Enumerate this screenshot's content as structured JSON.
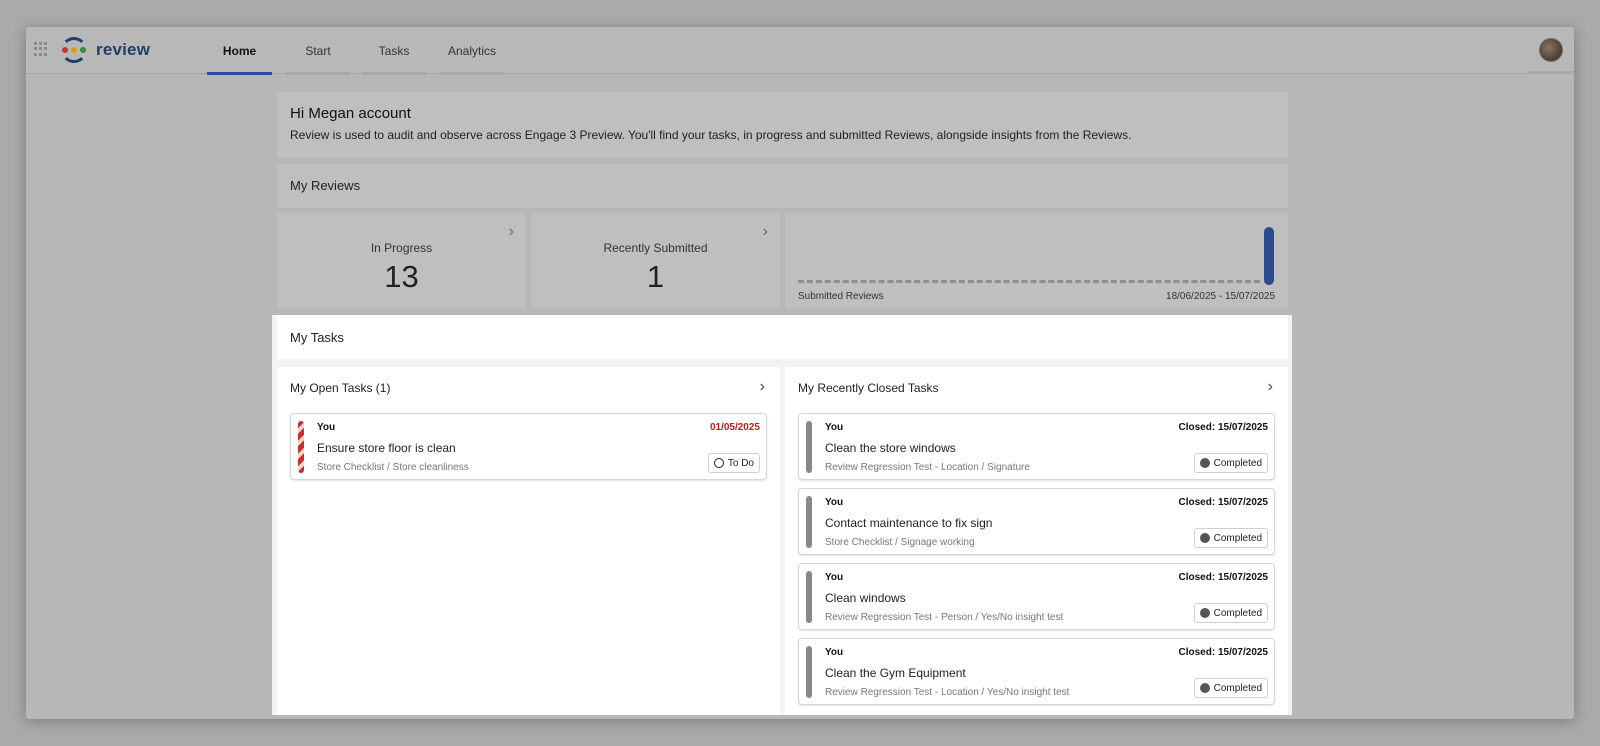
{
  "app": {
    "logo_text": "review",
    "avatar_icon": "user-avatar"
  },
  "nav": {
    "tabs": [
      {
        "label": "Home"
      },
      {
        "label": "Start"
      },
      {
        "label": "Tasks"
      },
      {
        "label": "Analytics"
      }
    ]
  },
  "greeting": {
    "title": "Hi Megan account",
    "description": "Review is used to audit and observe across Engage 3 Preview. You'll find your tasks, in progress and submitted Reviews, alongside insights from the Reviews."
  },
  "reviews": {
    "heading": "My Reviews",
    "in_progress": {
      "label": "In Progress",
      "value": "13"
    },
    "recently_submitted": {
      "label": "Recently Submitted",
      "value": "1"
    },
    "chart": {
      "label": "Submitted Reviews",
      "range": "18/06/2025 - 15/07/2025"
    }
  },
  "chart_data": {
    "type": "bar",
    "title": "Submitted Reviews",
    "x_range": [
      "18/06/2025",
      "15/07/2025"
    ],
    "series": [
      {
        "values": [
          0,
          0,
          0,
          0,
          0,
          0,
          0,
          0,
          0,
          0,
          0,
          0,
          0,
          0,
          0,
          0,
          0,
          0,
          0,
          0,
          0,
          0,
          0,
          0,
          0,
          0,
          0,
          1
        ]
      }
    ],
    "bar_color": "#2b4b8c"
  },
  "tasks": {
    "heading": "My Tasks",
    "open": {
      "heading": "My Open Tasks (1)",
      "items": [
        {
          "who": "You",
          "date": "01/05/2025",
          "title": "Ensure store floor is clean",
          "path": "Store Checklist / Store cleanliness",
          "status": "To Do"
        }
      ]
    },
    "closed": {
      "heading": "My Recently Closed Tasks",
      "items": [
        {
          "who": "You",
          "date": "Closed: 15/07/2025",
          "title": "Clean the store windows",
          "path": "Review Regression Test - Location / Signature",
          "status": "Completed"
        },
        {
          "who": "You",
          "date": "Closed: 15/07/2025",
          "title": "Contact maintenance to fix sign",
          "path": "Store Checklist / Signage working",
          "status": "Completed"
        },
        {
          "who": "You",
          "date": "Closed: 15/07/2025",
          "title": "Clean windows",
          "path": "Review Regression Test - Person / Yes/No insight test",
          "status": "Completed"
        },
        {
          "who": "You",
          "date": "Closed: 15/07/2025",
          "title": "Clean the Gym Equipment",
          "path": "Review Regression Test - Location / Yes/No insight test",
          "status": "Completed"
        }
      ]
    }
  },
  "colors": {
    "accent": "#2a4e92",
    "overdue": "#b22222"
  }
}
